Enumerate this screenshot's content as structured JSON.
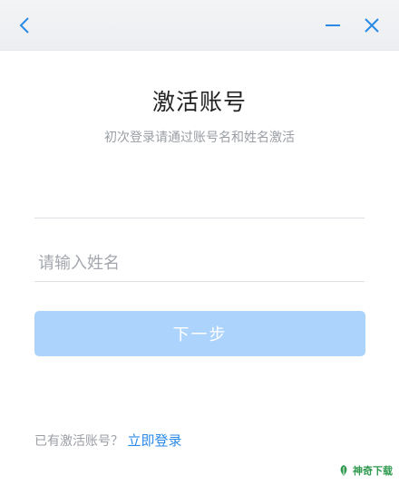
{
  "titlebar": {
    "back_icon": "chevron-left-icon",
    "minimize_icon": "minus-icon",
    "close_icon": "close-icon",
    "icon_color": "#2b8ae6"
  },
  "heading": {
    "title": "激活账号",
    "subtitle": "初次登录请通过账号名和姓名激活"
  },
  "form": {
    "account_value": "",
    "name_placeholder": "请输入姓名",
    "name_value": "",
    "next_label": "下一步",
    "next_button_color": "#acd3fb"
  },
  "footer": {
    "prompt": "已有激活账号？",
    "login_link": "立即登录",
    "link_color": "#2b8ae6"
  },
  "watermark": {
    "text": "神奇下载"
  }
}
